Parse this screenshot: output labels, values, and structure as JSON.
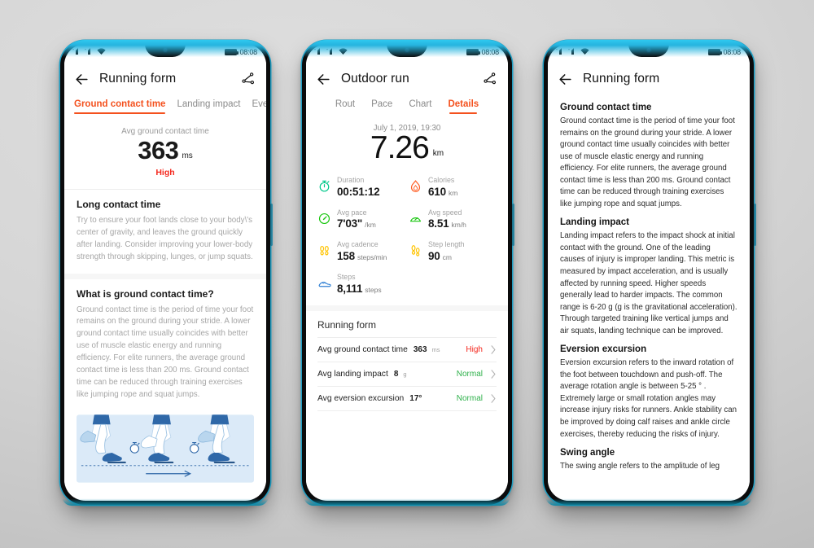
{
  "status_bar": {
    "time": "08:08",
    "signal_icon": "signal-bars-icon",
    "wifi_icon": "wifi-icon",
    "battery_icon": "battery-icon"
  },
  "theme": {
    "accent": "#f4511e",
    "high": "#f4281e",
    "normal": "#2fb14b",
    "frame_edge": "#2ec8ef",
    "muted": "#a6a6a6"
  },
  "phone1": {
    "appbar": {
      "title": "Running form",
      "back_icon": "back-arrow-icon",
      "share_icon": "share-icon"
    },
    "tabs": [
      {
        "label": "Ground contact time",
        "active": true
      },
      {
        "label": "Landing impact",
        "active": false
      },
      {
        "label": "Ever",
        "active": false
      }
    ],
    "hero": {
      "label": "Avg ground contact time",
      "value": "363",
      "unit": "ms",
      "status": "High"
    },
    "sections": [
      {
        "heading": "Long contact time",
        "body": "Try to ensure your foot lands close to your body\\'s center of gravity, and leaves the ground quickly after landing. Consider improving your lower-body strength through skipping, lunges, or jump squats."
      },
      {
        "heading": "What is ground contact time?",
        "body": "Ground contact time is the period of time your foot remains on the ground during your stride. A lower ground contact time usually coincides with better use of muscle elastic energy and running efficiency. For elite runners, the average ground contact time is less than 200 ms. Ground contact time can be reduced through training exercises like jumping rope and squat jumps."
      }
    ],
    "illustration": {
      "name": "running-gait-illustration",
      "alt": "Three runner legs over a dashed ground line with stopwatches and a forward arrow"
    }
  },
  "phone2": {
    "appbar": {
      "title": "Outdoor run",
      "back_icon": "back-arrow-icon",
      "share_icon": "share-icon"
    },
    "tabs": [
      {
        "label": "Rout",
        "active": false
      },
      {
        "label": "Pace",
        "active": false
      },
      {
        "label": "Chart",
        "active": false
      },
      {
        "label": "Details",
        "active": true
      }
    ],
    "summary": {
      "date": "July 1, 2019, 19:30",
      "distance": "7.26",
      "distance_unit": "km"
    },
    "stats": [
      {
        "icon": "stopwatch-icon",
        "label": "Duration",
        "value": "00:51:12",
        "unit": ""
      },
      {
        "icon": "flame-icon",
        "label": "Calories",
        "value": "610",
        "unit": "km"
      },
      {
        "icon": "pace-gauge-icon",
        "label": "Avg pace",
        "value": "7'03\"",
        "unit": "/km"
      },
      {
        "icon": "speedometer-icon",
        "label": "Avg speed",
        "value": "8.51",
        "unit": "km/h"
      },
      {
        "icon": "footprints-icon",
        "label": "Avg cadence",
        "value": "158",
        "unit": "steps/min"
      },
      {
        "icon": "footstep-icon",
        "label": "Step length",
        "value": "90",
        "unit": "cm"
      },
      {
        "icon": "shoe-icon",
        "label": "Steps",
        "value": "8,111",
        "unit": "steps"
      }
    ],
    "running_form": {
      "title": "Running form",
      "rows": [
        {
          "name": "Avg ground contact time",
          "value": "363",
          "unit": "ms",
          "state": "High",
          "state_kind": "high"
        },
        {
          "name": "Avg landing impact",
          "value": "8",
          "unit": "g",
          "state": "Normal",
          "state_kind": "normal"
        },
        {
          "name": "Avg eversion excursion",
          "value": "17°",
          "unit": "",
          "state": "Normal",
          "state_kind": "normal"
        }
      ]
    }
  },
  "phone3": {
    "appbar": {
      "title": "Running form",
      "back_icon": "back-arrow-icon"
    },
    "sections": [
      {
        "heading": "Ground contact time",
        "body": "Ground contact time is the period of time your foot remains on the ground during your stride. A lower ground contact time usually coincides with better use of muscle elastic energy and running efficiency. For elite runners, the average ground contact time is less than 200 ms. Ground contact time can be reduced through training exercises like jumping rope and squat jumps."
      },
      {
        "heading": "Landing impact",
        "body": "Landing impact refers to the impact shock at initial contact with the ground. One of the leading causes of injury is improper landing. This metric is measured by impact acceleration, and is usually affected by running speed. Higher speeds generally lead to harder impacts. The common range is 6-20 g (g is the gravitational acceleration). Through targeted training like vertical jumps and air squats, landing technique can be improved."
      },
      {
        "heading": "Eversion excursion",
        "body": "Eversion excursion refers to the inward rotation of the foot between touchdown and push-off. The average rotation angle is between 5-25 ° . Extremely large or small rotation angles may increase injury risks for runners. Ankle stability can be improved by doing calf raises and ankle circle exercises, thereby reducing the risks of injury."
      },
      {
        "heading": "Swing angle",
        "body": "The swing angle refers to the amplitude of leg"
      }
    ]
  }
}
